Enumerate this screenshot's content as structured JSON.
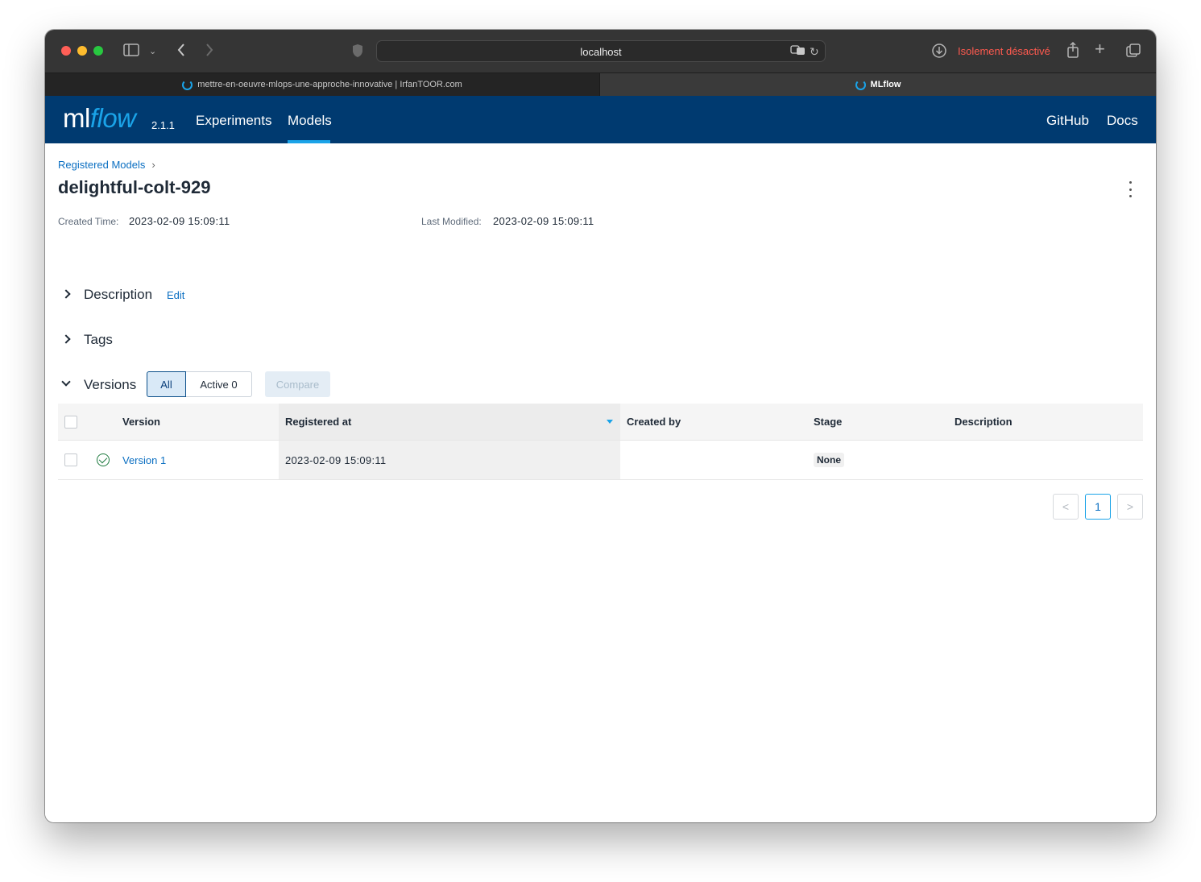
{
  "browser": {
    "address": "localhost",
    "isolation_status": "Isolement désactivé",
    "tabs": [
      {
        "title": "mettre-en-oeuvre-mlops-une-approche-innovative | IrfanTOOR.com",
        "active": false
      },
      {
        "title": "MLflow",
        "active": true
      }
    ]
  },
  "navbar": {
    "logo_ml": "ml",
    "logo_flow": "flow",
    "version": "2.1.1",
    "links": [
      "Experiments",
      "Models"
    ],
    "active_link": "Models",
    "right_links": [
      "GitHub",
      "Docs"
    ]
  },
  "page": {
    "breadcrumb": "Registered Models",
    "breadcrumb_sep": "›",
    "title": "delightful-colt-929",
    "created_label": "Created Time:",
    "created_value": "2023-02-09 15:09:11",
    "modified_label": "Last Modified:",
    "modified_value": "2023-02-09 15:09:11",
    "sections": {
      "description": "Description",
      "edit": "Edit",
      "tags": "Tags",
      "versions": "Versions"
    },
    "filters": {
      "all": "All",
      "active": "Active 0",
      "compare": "Compare"
    }
  },
  "table": {
    "columns": [
      "Version",
      "Registered at",
      "Created by",
      "Stage",
      "Description"
    ],
    "rows": [
      {
        "version": "Version 1",
        "registered_at": "2023-02-09 15:09:11",
        "created_by": "",
        "stage": "None",
        "description": ""
      }
    ]
  },
  "pagination": {
    "prev": "<",
    "current": "1",
    "next": ">"
  },
  "colors": {
    "navbar_bg": "#003a70",
    "accent": "#1aa3e8",
    "link": "#0b6fc2",
    "isolation_warning": "#ff5a4f"
  }
}
